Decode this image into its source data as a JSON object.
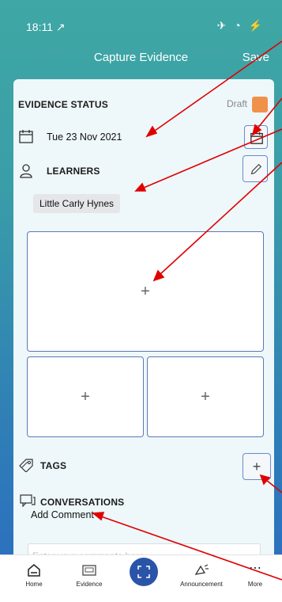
{
  "status_bar": {
    "time": "18:11 ↗",
    "icons": "✈ ◔ ⚡"
  },
  "nav": {
    "title": "Capture Evidence",
    "save_label": "Save"
  },
  "evidence_status": {
    "label": "EVIDENCE STATUS",
    "value": "Draft",
    "color": "#f0914a"
  },
  "date": {
    "value": "Tue 23 Nov 2021"
  },
  "learners": {
    "label": "LEARNERS",
    "items": [
      "Little Carly  Hynes"
    ]
  },
  "media": {
    "plus": "+"
  },
  "tags": {
    "label": "TAGS",
    "add": "+"
  },
  "conversations": {
    "label": "CONVERSATIONS",
    "add_comment_label": "Add Comment",
    "placeholder": "Enter your comments here"
  },
  "tabs": [
    {
      "label": "Home",
      "icon": "home-icon"
    },
    {
      "label": "Evidence",
      "icon": "evidence-icon"
    },
    {
      "label": "",
      "icon": "capture-icon"
    },
    {
      "label": "Announcement",
      "icon": "megaphone-icon"
    },
    {
      "label": "More",
      "icon": "more-icon"
    }
  ]
}
